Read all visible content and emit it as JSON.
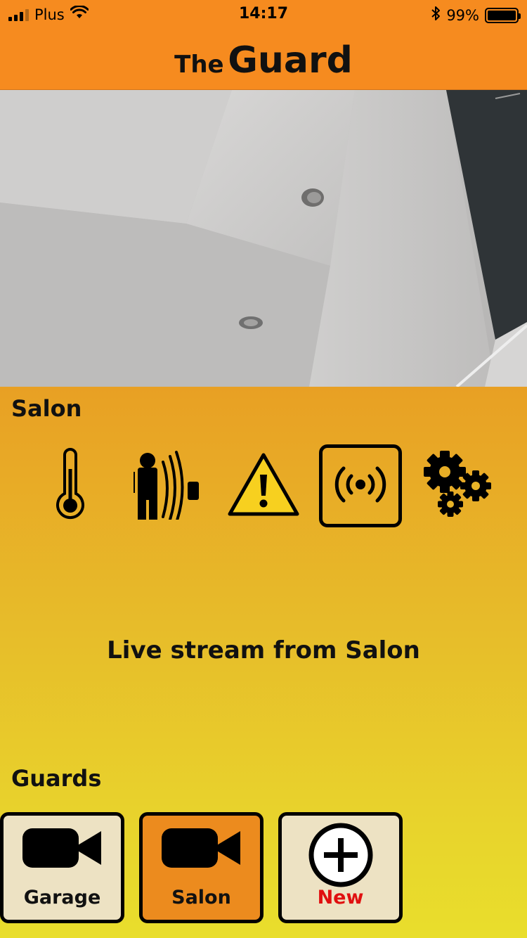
{
  "status_bar": {
    "carrier": "Plus",
    "time": "14:17",
    "battery_percent": "99%",
    "battery_level": 0.99,
    "icons": [
      "signal-icon",
      "wifi-icon",
      "bluetooth-icon",
      "battery-icon"
    ]
  },
  "nav": {
    "title_prefix": "The",
    "title_main": "Guard"
  },
  "camera": {
    "name": "Salon"
  },
  "controls": {
    "items": [
      {
        "icon": "thermometer-icon",
        "selected": false
      },
      {
        "icon": "motion-sensor-icon",
        "selected": false
      },
      {
        "icon": "warning-icon",
        "selected": false
      },
      {
        "icon": "live-stream-icon",
        "selected": true
      },
      {
        "icon": "settings-gears-icon",
        "selected": false
      }
    ]
  },
  "live": {
    "text": "Live stream from Salon"
  },
  "guards": {
    "title": "Guards",
    "items": [
      {
        "label": "Garage",
        "icon": "video-camera-icon",
        "active": false
      },
      {
        "label": "Salon",
        "icon": "video-camera-icon",
        "active": true
      },
      {
        "label": "New",
        "icon": "add-circle-icon",
        "active": false
      }
    ]
  },
  "colors": {
    "header": "#f68b1f",
    "gradient_top": "#e8a024",
    "gradient_bottom": "#e9de2c",
    "card_bg": "#ede2c3",
    "card_active_bg": "#ec8b1e",
    "new_label": "#e01010"
  }
}
